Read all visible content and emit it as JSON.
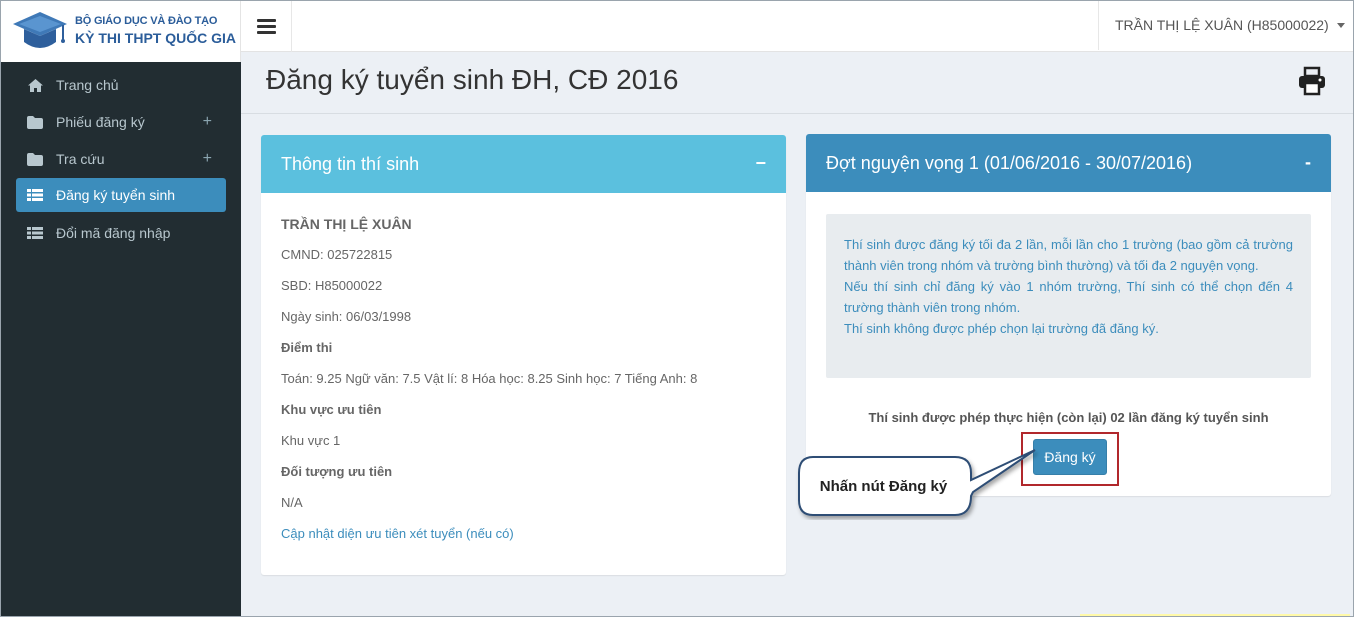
{
  "brand": {
    "line1": "BỘ GIÁO DỤC VÀ ĐÀO TẠO",
    "line2": "KỲ THI THPT QUỐC GIA"
  },
  "navbar": {
    "user": "TRẦN THỊ LỆ XUÂN (H85000022)"
  },
  "sidebar": {
    "items": [
      {
        "label": "Trang chủ",
        "icon": "home-icon"
      },
      {
        "label": "Phiếu đăng ký",
        "icon": "folder-icon",
        "expandable": true
      },
      {
        "label": "Tra cứu",
        "icon": "folder-icon",
        "expandable": true
      },
      {
        "label": "Đăng ký tuyển sinh",
        "icon": "list-icon",
        "active": true
      },
      {
        "label": "Đổi mã đăng nhập",
        "icon": "list-icon"
      }
    ],
    "plus": "+"
  },
  "page": {
    "title": "Đăng ký tuyển sinh ĐH, CĐ 2016"
  },
  "candidate_panel": {
    "title": "Thông tin thí sinh",
    "minimize": "−",
    "name": "TRẦN THỊ LỆ XUÂN",
    "cmnd": "CMND: 025722815",
    "sbd": "SBD: H85000022",
    "dob": "Ngày sinh: 06/03/1998",
    "scores_label": "Điểm thi",
    "scores": "Toán: 9.25 Ngữ văn: 7.5 Vật lí: 8 Hóa học: 8.25 Sinh học: 7 Tiếng Anh: 8",
    "region_label": "Khu vực ưu tiên",
    "region": "Khu vực 1",
    "priority_label": "Đối tượng ưu tiên",
    "priority": "N/A",
    "update_link": "Cập nhật diện ưu tiên xét tuyển (nếu có)"
  },
  "round_panel": {
    "title": "Đợt nguyện vọng 1 (01/06/2016 - 30/07/2016)",
    "minimize": "-",
    "notice_1": "Thí sinh được đăng ký tối đa 2 lần, mỗi lần cho 1 trường (bao gồm cả trường thành viên trong nhóm và trường bình thường) và tối đa 2 nguyện vọng.",
    "notice_2": "Nếu thí sinh chỉ đăng ký vào 1 nhóm trường, Thí sinh có thể chọn đến 4 trường thành viên trong nhóm.",
    "notice_3": "Thí sinh không được phép chọn lại trường đã đăng ký.",
    "remaining": "Thí sinh được phép thực hiện (còn lại) 02 lần đăng ký tuyển sinh",
    "register_button": "Đăng ký"
  },
  "callout": {
    "text": "Nhấn nút Đăng ký"
  },
  "colors": {
    "sidebar_bg": "#222d32",
    "active": "#3c8dbc",
    "info_header": "#5bc0de",
    "highlight_border": "#b1282c"
  }
}
